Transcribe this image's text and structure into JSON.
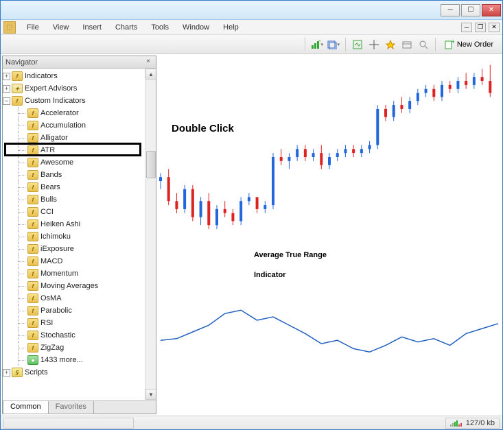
{
  "menu": {
    "items": [
      "File",
      "View",
      "Insert",
      "Charts",
      "Tools",
      "Window",
      "Help"
    ]
  },
  "toolbar": {
    "new_order": "New Order"
  },
  "navigator": {
    "title": "Navigator",
    "root": [
      {
        "label": "Indicators",
        "icon": "f",
        "expand": "plus"
      },
      {
        "label": "Expert Advisors",
        "icon": "expert",
        "expand": "plus"
      },
      {
        "label": "Custom Indicators",
        "icon": "f",
        "expand": "minus"
      }
    ],
    "custom_indicators": [
      "Accelerator",
      "Accumulation",
      "Alligator",
      "ATR",
      "Awesome",
      "Bands",
      "Bears",
      "Bulls",
      "CCI",
      "Heiken Ashi",
      "Ichimoku",
      "iExposure",
      "MACD",
      "Momentum",
      "Moving Averages",
      "OsMA",
      "Parabolic",
      "RSI",
      "Stochastic",
      "ZigZag"
    ],
    "more": "1433 more...",
    "scripts": "Scripts",
    "tabs": {
      "common": "Common",
      "favorites": "Favorites"
    },
    "highlighted_index": 3
  },
  "annotations": {
    "dbl": "Double Click",
    "title": "Average True Range Indicator"
  },
  "status": {
    "kb": "127/0 kb"
  },
  "chart_data": [
    {
      "type": "candlestick",
      "title": "",
      "xlabel": "",
      "ylabel": "",
      "x_range": [
        0,
        84
      ],
      "y_range": [
        0,
        100
      ],
      "series": [
        {
          "x": 0,
          "open": 38,
          "high": 42,
          "low": 34,
          "close": 40,
          "color": "blue"
        },
        {
          "x": 2,
          "open": 40,
          "high": 44,
          "low": 26,
          "close": 28,
          "color": "red"
        },
        {
          "x": 4,
          "open": 28,
          "high": 32,
          "low": 22,
          "close": 24,
          "color": "red"
        },
        {
          "x": 6,
          "open": 24,
          "high": 36,
          "low": 22,
          "close": 34,
          "color": "blue"
        },
        {
          "x": 8,
          "open": 34,
          "high": 36,
          "low": 18,
          "close": 20,
          "color": "red"
        },
        {
          "x": 10,
          "open": 20,
          "high": 30,
          "low": 16,
          "close": 28,
          "color": "blue"
        },
        {
          "x": 12,
          "open": 28,
          "high": 32,
          "low": 14,
          "close": 16,
          "color": "red"
        },
        {
          "x": 14,
          "open": 16,
          "high": 26,
          "low": 14,
          "close": 24,
          "color": "blue"
        },
        {
          "x": 16,
          "open": 24,
          "high": 28,
          "low": 20,
          "close": 22,
          "color": "red"
        },
        {
          "x": 18,
          "open": 22,
          "high": 24,
          "low": 16,
          "close": 18,
          "color": "red"
        },
        {
          "x": 20,
          "open": 18,
          "high": 30,
          "low": 16,
          "close": 28,
          "color": "blue"
        },
        {
          "x": 22,
          "open": 28,
          "high": 32,
          "low": 26,
          "close": 30,
          "color": "blue"
        },
        {
          "x": 24,
          "open": 30,
          "high": 30,
          "low": 22,
          "close": 24,
          "color": "red"
        },
        {
          "x": 26,
          "open": 24,
          "high": 28,
          "low": 22,
          "close": 26,
          "color": "blue"
        },
        {
          "x": 28,
          "open": 26,
          "high": 52,
          "low": 24,
          "close": 50,
          "color": "blue"
        },
        {
          "x": 30,
          "open": 50,
          "high": 54,
          "low": 46,
          "close": 48,
          "color": "red"
        },
        {
          "x": 32,
          "open": 48,
          "high": 52,
          "low": 44,
          "close": 50,
          "color": "blue"
        },
        {
          "x": 34,
          "open": 50,
          "high": 56,
          "low": 48,
          "close": 54,
          "color": "blue"
        },
        {
          "x": 36,
          "open": 54,
          "high": 56,
          "low": 48,
          "close": 50,
          "color": "red"
        },
        {
          "x": 38,
          "open": 50,
          "high": 54,
          "low": 48,
          "close": 52,
          "color": "blue"
        },
        {
          "x": 40,
          "open": 52,
          "high": 56,
          "low": 44,
          "close": 46,
          "color": "red"
        },
        {
          "x": 42,
          "open": 46,
          "high": 52,
          "low": 44,
          "close": 50,
          "color": "blue"
        },
        {
          "x": 44,
          "open": 50,
          "high": 54,
          "low": 48,
          "close": 52,
          "color": "blue"
        },
        {
          "x": 46,
          "open": 52,
          "high": 56,
          "low": 50,
          "close": 54,
          "color": "blue"
        },
        {
          "x": 48,
          "open": 54,
          "high": 56,
          "low": 50,
          "close": 52,
          "color": "red"
        },
        {
          "x": 50,
          "open": 52,
          "high": 56,
          "low": 50,
          "close": 54,
          "color": "blue"
        },
        {
          "x": 52,
          "open": 54,
          "high": 58,
          "low": 52,
          "close": 56,
          "color": "blue"
        },
        {
          "x": 54,
          "open": 56,
          "high": 76,
          "low": 54,
          "close": 74,
          "color": "blue"
        },
        {
          "x": 56,
          "open": 74,
          "high": 76,
          "low": 68,
          "close": 70,
          "color": "red"
        },
        {
          "x": 58,
          "open": 70,
          "high": 78,
          "low": 68,
          "close": 76,
          "color": "blue"
        },
        {
          "x": 60,
          "open": 76,
          "high": 80,
          "low": 72,
          "close": 74,
          "color": "red"
        },
        {
          "x": 62,
          "open": 74,
          "high": 80,
          "low": 72,
          "close": 78,
          "color": "blue"
        },
        {
          "x": 64,
          "open": 78,
          "high": 84,
          "low": 76,
          "close": 82,
          "color": "blue"
        },
        {
          "x": 66,
          "open": 82,
          "high": 86,
          "low": 80,
          "close": 84,
          "color": "blue"
        },
        {
          "x": 68,
          "open": 84,
          "high": 86,
          "low": 78,
          "close": 80,
          "color": "red"
        },
        {
          "x": 70,
          "open": 80,
          "high": 88,
          "low": 78,
          "close": 86,
          "color": "blue"
        },
        {
          "x": 72,
          "open": 86,
          "high": 88,
          "low": 82,
          "close": 84,
          "color": "red"
        },
        {
          "x": 74,
          "open": 84,
          "high": 90,
          "low": 82,
          "close": 88,
          "color": "blue"
        },
        {
          "x": 76,
          "open": 88,
          "high": 92,
          "low": 84,
          "close": 86,
          "color": "red"
        },
        {
          "x": 78,
          "open": 86,
          "high": 92,
          "low": 84,
          "close": 90,
          "color": "blue"
        },
        {
          "x": 80,
          "open": 90,
          "high": 94,
          "low": 86,
          "close": 88,
          "color": "red"
        },
        {
          "x": 82,
          "open": 88,
          "high": 96,
          "low": 80,
          "close": 82,
          "color": "red"
        }
      ]
    },
    {
      "type": "line",
      "title": "ATR",
      "xlabel": "",
      "ylabel": "",
      "x_range": [
        0,
        84
      ],
      "y_range": [
        0,
        100
      ],
      "series": [
        {
          "name": "ATR",
          "color": "#2060c0",
          "points": [
            [
              0,
              40
            ],
            [
              4,
              42
            ],
            [
              8,
              50
            ],
            [
              12,
              58
            ],
            [
              16,
              72
            ],
            [
              20,
              76
            ],
            [
              24,
              64
            ],
            [
              28,
              68
            ],
            [
              32,
              58
            ],
            [
              36,
              48
            ],
            [
              40,
              36
            ],
            [
              44,
              40
            ],
            [
              48,
              30
            ],
            [
              52,
              26
            ],
            [
              56,
              34
            ],
            [
              60,
              44
            ],
            [
              64,
              38
            ],
            [
              68,
              42
            ],
            [
              72,
              34
            ],
            [
              76,
              48
            ],
            [
              80,
              54
            ],
            [
              84,
              60
            ]
          ]
        }
      ]
    }
  ]
}
